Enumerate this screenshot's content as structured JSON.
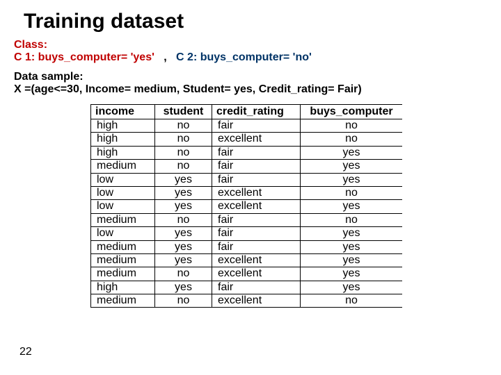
{
  "title": "Training dataset",
  "class_section": {
    "label": "Class:",
    "c1": "C 1: buys_computer= 'yes'",
    "separator": ",",
    "c2": "C 2: buys_computer= 'no'"
  },
  "sample_section": {
    "label": "Data sample:",
    "text": "X =(age<=30, Income= medium, Student= yes, Credit_rating= Fair)"
  },
  "chart_data": {
    "type": "table",
    "columns": [
      "income",
      "student",
      "credit_rating",
      "buys_computer"
    ],
    "rows": [
      [
        "high",
        "no",
        "fair",
        "no"
      ],
      [
        "high",
        "no",
        "excellent",
        "no"
      ],
      [
        "high",
        "no",
        "fair",
        "yes"
      ],
      [
        "medium",
        "no",
        "fair",
        "yes"
      ],
      [
        "low",
        "yes",
        "fair",
        "yes"
      ],
      [
        "low",
        "yes",
        "excellent",
        "no"
      ],
      [
        "low",
        "yes",
        "excellent",
        "yes"
      ],
      [
        "medium",
        "no",
        "fair",
        "no"
      ],
      [
        "low",
        "yes",
        "fair",
        "yes"
      ],
      [
        "medium",
        "yes",
        "fair",
        "yes"
      ],
      [
        "medium",
        "yes",
        "excellent",
        "yes"
      ],
      [
        "medium",
        "no",
        "excellent",
        "yes"
      ],
      [
        "high",
        "yes",
        "fair",
        "yes"
      ],
      [
        "medium",
        "no",
        "excellent",
        "no"
      ]
    ]
  },
  "page_number": "22"
}
